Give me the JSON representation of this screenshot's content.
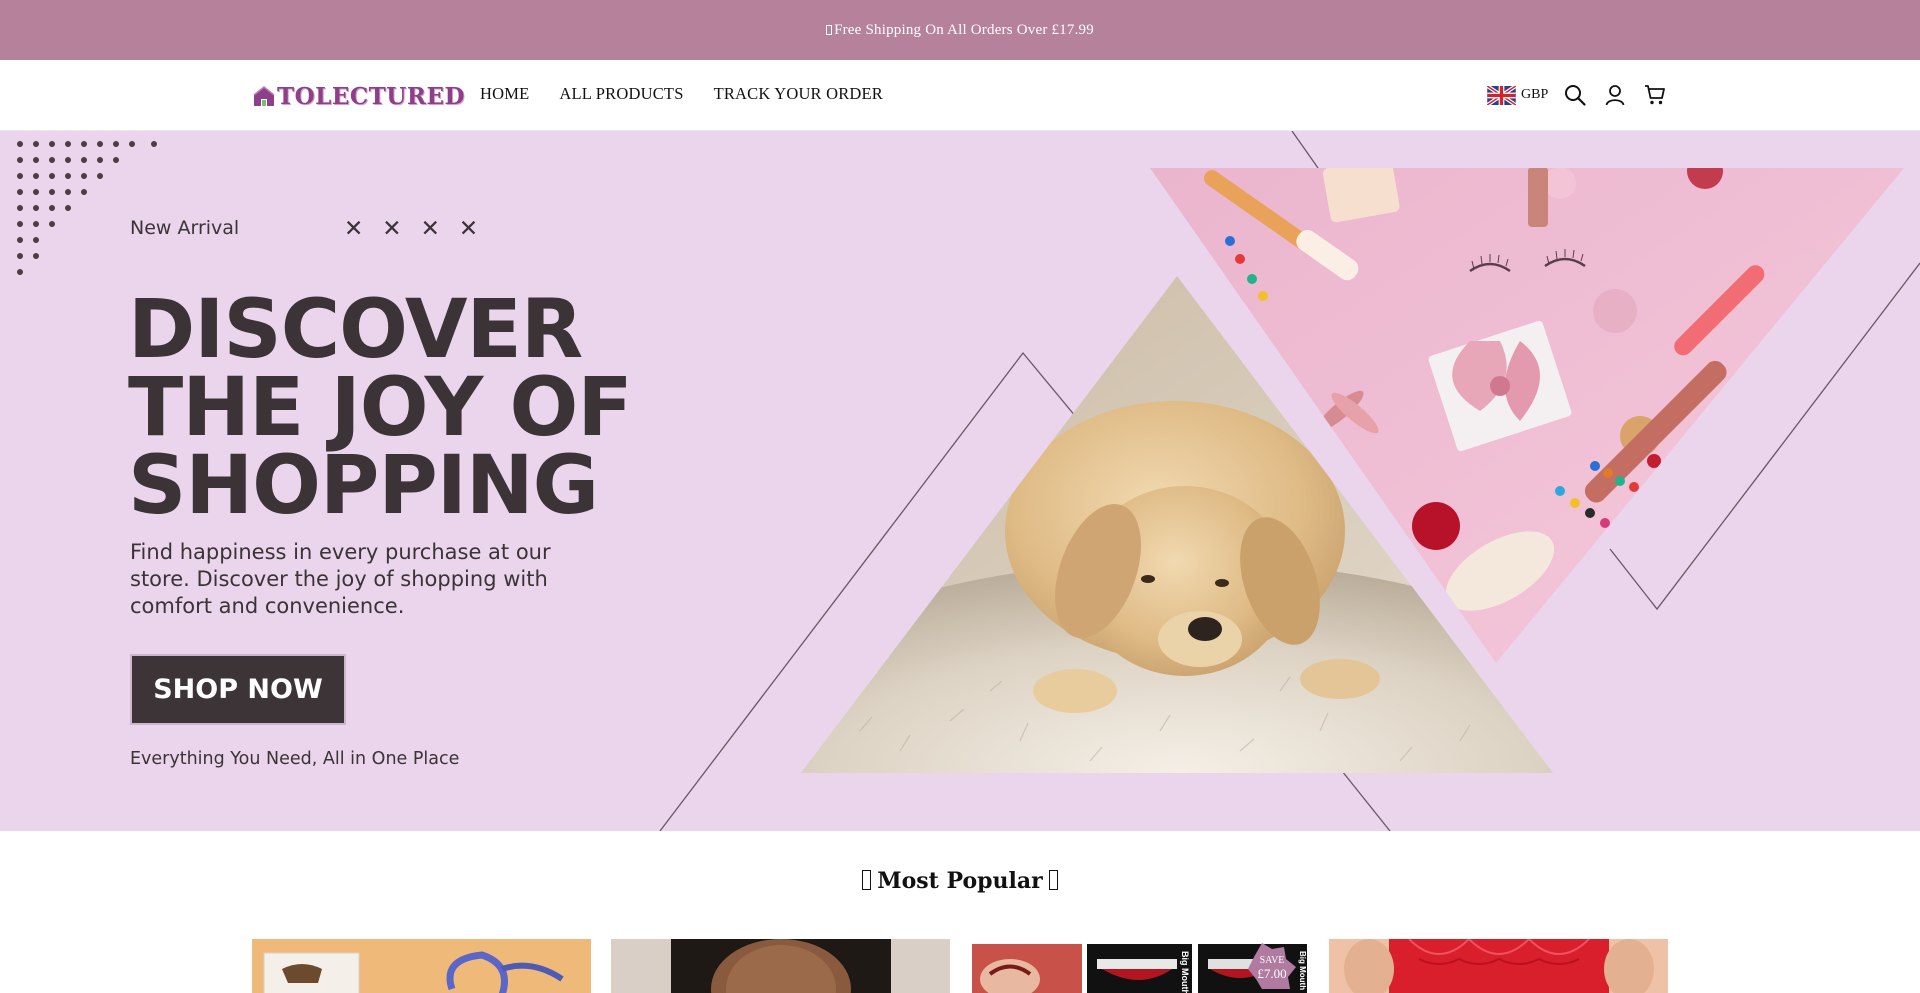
{
  "announcement": {
    "text": "Free Shipping On All Orders Over £17.99"
  },
  "header": {
    "logo_text": "TOLECTURED",
    "nav": [
      {
        "label": "HOME"
      },
      {
        "label": "ALL PRODUCTS"
      },
      {
        "label": "TRACK YOUR ORDER"
      }
    ],
    "currency": {
      "label": "GBP",
      "flag_icon": "uk-flag-icon"
    },
    "icons": [
      "search-icon",
      "account-icon",
      "cart-icon"
    ]
  },
  "hero": {
    "eyebrow": "New Arrival",
    "marks": [
      "✕",
      "✕",
      "✕",
      "✕"
    ],
    "headline": [
      "DISCOVER",
      "THE JOY OF",
      "SHOPPING"
    ],
    "subcopy": "Find happiness in every purchase at our store. Discover the joy of shopping with comfort and convenience.",
    "cta_label": "SHOP NOW",
    "tagline": "Everything You Need, All in One Place",
    "background_color": "#ead5ec",
    "text_color": "#3b3336"
  },
  "most_popular": {
    "title": "Most Popular",
    "products": [
      {
        "image": "sunglasses-product-image"
      },
      {
        "image": "hair-product-image"
      },
      {
        "image": "halloween-tattoo-product-image",
        "badge_line1": "SAVE",
        "badge_line2": "£7.00",
        "product_texts": [
          "Big Mouth Tattoo",
          "Big Mouth"
        ]
      },
      {
        "image": "red-lace-product-image"
      }
    ]
  },
  "colors": {
    "announcement_bg": "#b6819a",
    "brand": "#8e3f8a",
    "button_bg": "#3d3438"
  }
}
